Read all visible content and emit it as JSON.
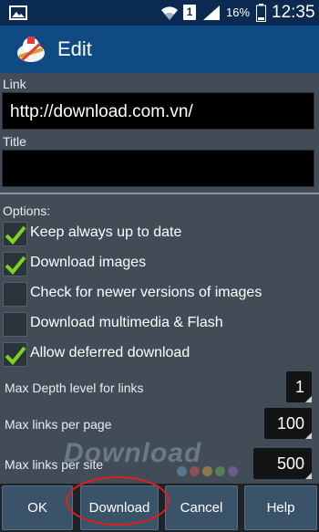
{
  "status_bar": {
    "sim_slot": "1",
    "battery_percent": "16%",
    "time": "12:35"
  },
  "action_bar": {
    "title": "Edit"
  },
  "form": {
    "link_label": "Link",
    "link_value": "http://download.com.vn/",
    "title_label": "Title",
    "title_value": "",
    "options_label": "Options:",
    "options": [
      {
        "label": "Keep always up to date",
        "checked": true
      },
      {
        "label": "Download images",
        "checked": true
      },
      {
        "label": "Check for newer versions of images",
        "checked": false
      },
      {
        "label": "Download multimedia & Flash",
        "checked": false
      },
      {
        "label": "Allow deferred download",
        "checked": true
      }
    ],
    "numbers": [
      {
        "label": "Max Depth level for links",
        "value": "1"
      },
      {
        "label": "Max links per page",
        "value": "100"
      },
      {
        "label": "Max links per site",
        "value": "500"
      }
    ]
  },
  "watermark": {
    "text": "Download"
  },
  "buttons": {
    "ok": "OK",
    "download": "Download",
    "cancel": "Cancel",
    "help": "Help"
  },
  "colors": {
    "status_bar": "#0b2a52",
    "action_bar": "#0f4a82",
    "content_bg": "#414c57",
    "check_green": "#7ed321",
    "highlight": "#e01e1e"
  }
}
